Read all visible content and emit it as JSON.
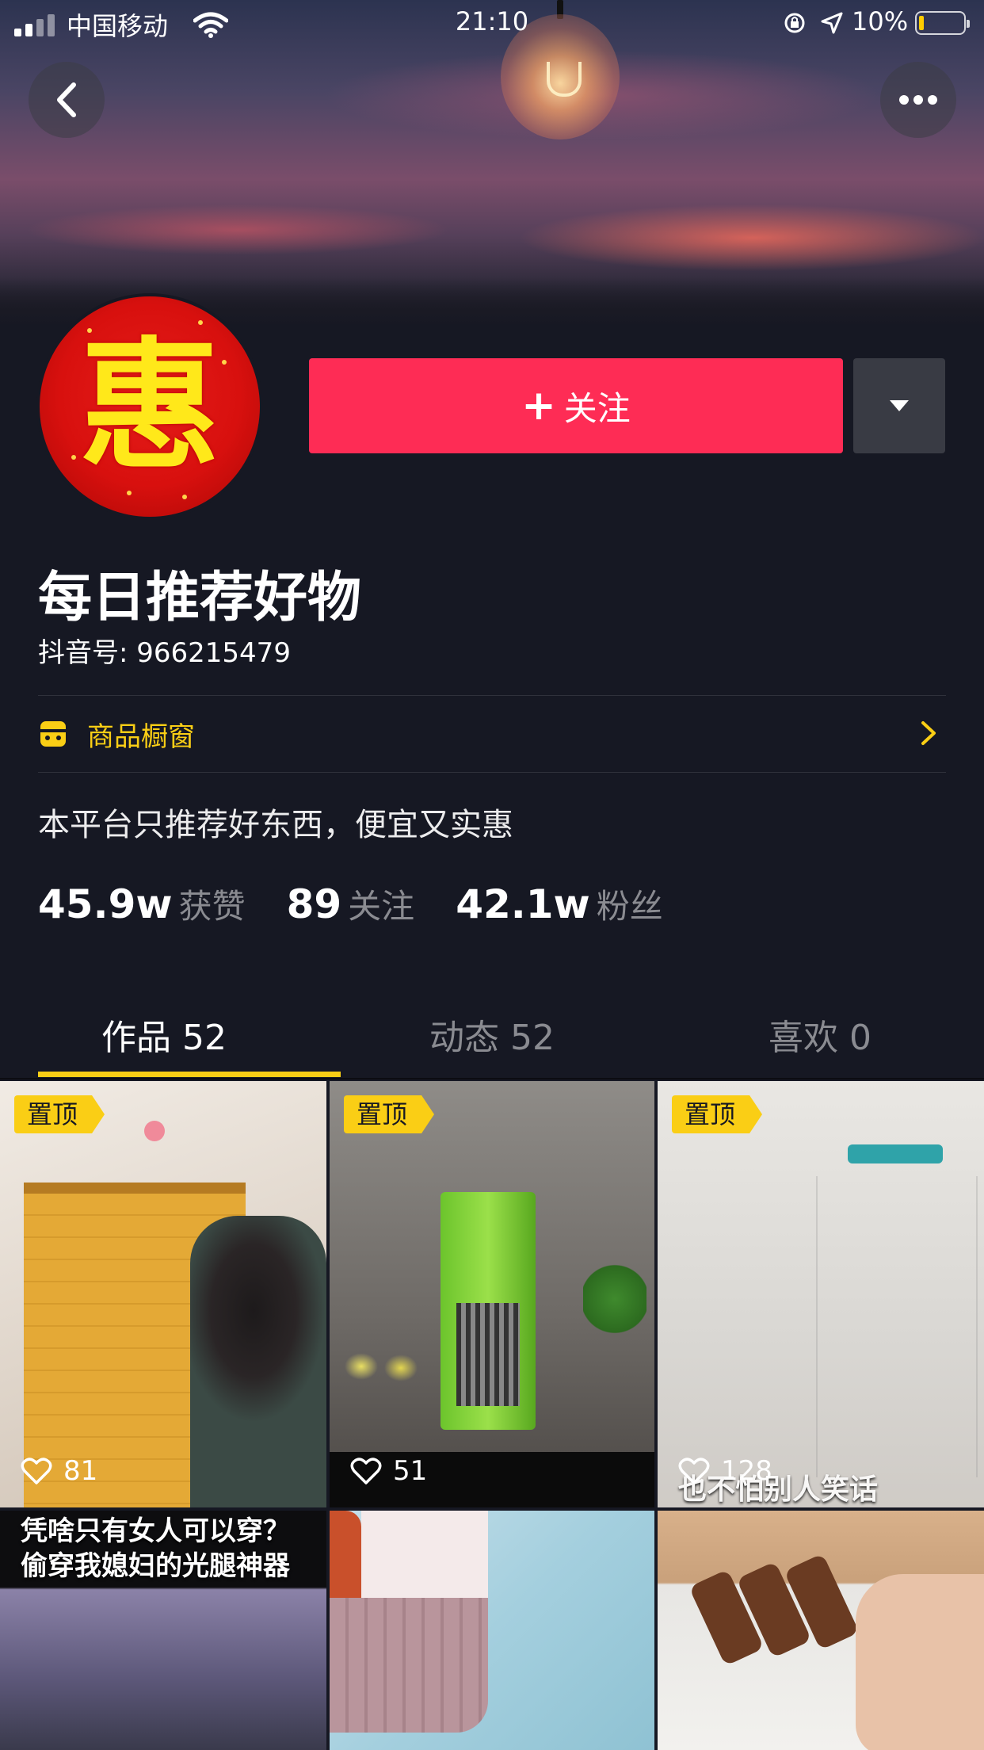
{
  "status_bar": {
    "carrier": "中国移动",
    "time": "21:10",
    "battery": "10%"
  },
  "profile": {
    "avatar_char": "惠",
    "follow_label": "关注",
    "follow_plus": "+",
    "name": "每日推荐好物",
    "douyin_id": "抖音号: 966215479",
    "shop_label": "商品橱窗",
    "bio": "本平台只推荐好东西，便宜又实惠"
  },
  "stats": [
    {
      "value": "45.9w",
      "label": "获赞"
    },
    {
      "value": "89",
      "label": "关注"
    },
    {
      "value": "42.1w",
      "label": "粉丝"
    }
  ],
  "tabs": [
    {
      "label": "作品 52",
      "active": true
    },
    {
      "label": "动态 52",
      "active": false
    },
    {
      "label": "喜欢 0",
      "active": false
    }
  ],
  "videos": [
    {
      "pinned": true,
      "pin_label": "置顶",
      "likes": "81"
    },
    {
      "pinned": true,
      "pin_label": "置顶",
      "likes": "51"
    },
    {
      "pinned": true,
      "pin_label": "置顶",
      "likes": "128",
      "caption": "也不怕别人笑话"
    },
    {
      "pinned": false,
      "caption_line1": "凭啥只有女人可以穿？",
      "caption_line2": "偷穿我媳妇的光腿神器"
    },
    {
      "pinned": false
    },
    {
      "pinned": false
    }
  ],
  "colors": {
    "background": "#161823",
    "follow": "#fe2c55",
    "accent": "#face15"
  }
}
